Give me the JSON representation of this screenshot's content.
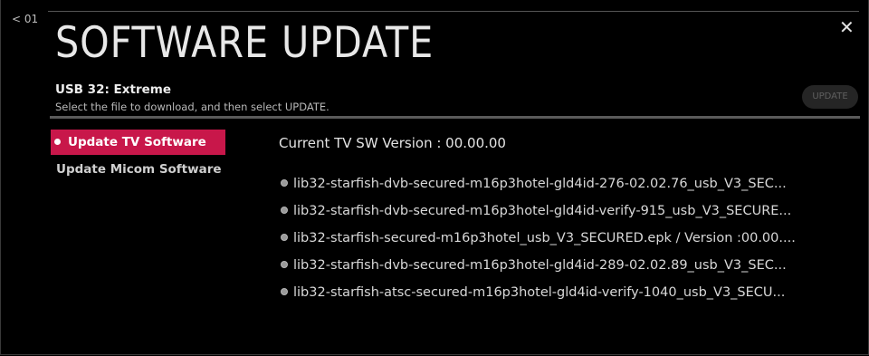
{
  "nav": {
    "back_label": "< 01",
    "close_label": "✕"
  },
  "header": {
    "title": "SOFTWARE UPDATE",
    "device": "USB 32: Extreme",
    "instruction": "Select the file to download, and then select UPDATE.",
    "update_label": "UPDATE"
  },
  "menu": {
    "items": [
      {
        "label": "Update TV Software",
        "active": true
      },
      {
        "label": "Update Micom Software",
        "active": false
      }
    ]
  },
  "content": {
    "current_version": "Current TV SW Version : 00.00.00",
    "files": [
      "lib32-starfish-dvb-secured-m16p3hotel-gld4id-276-02.02.76_usb_V3_SEC...",
      "lib32-starfish-dvb-secured-m16p3hotel-gld4id-verify-915_usb_V3_SECURE...",
      "lib32-starfish-secured-m16p3hotel_usb_V3_SECURED.epk / Version :00.00....",
      "lib32-starfish-dvb-secured-m16p3hotel-gld4id-289-02.02.89_usb_V3_SEC...",
      "lib32-starfish-atsc-secured-m16p3hotel-gld4id-verify-1040_usb_V3_SECU..."
    ]
  },
  "colors": {
    "accent": "#c8174a",
    "background": "#000000"
  }
}
